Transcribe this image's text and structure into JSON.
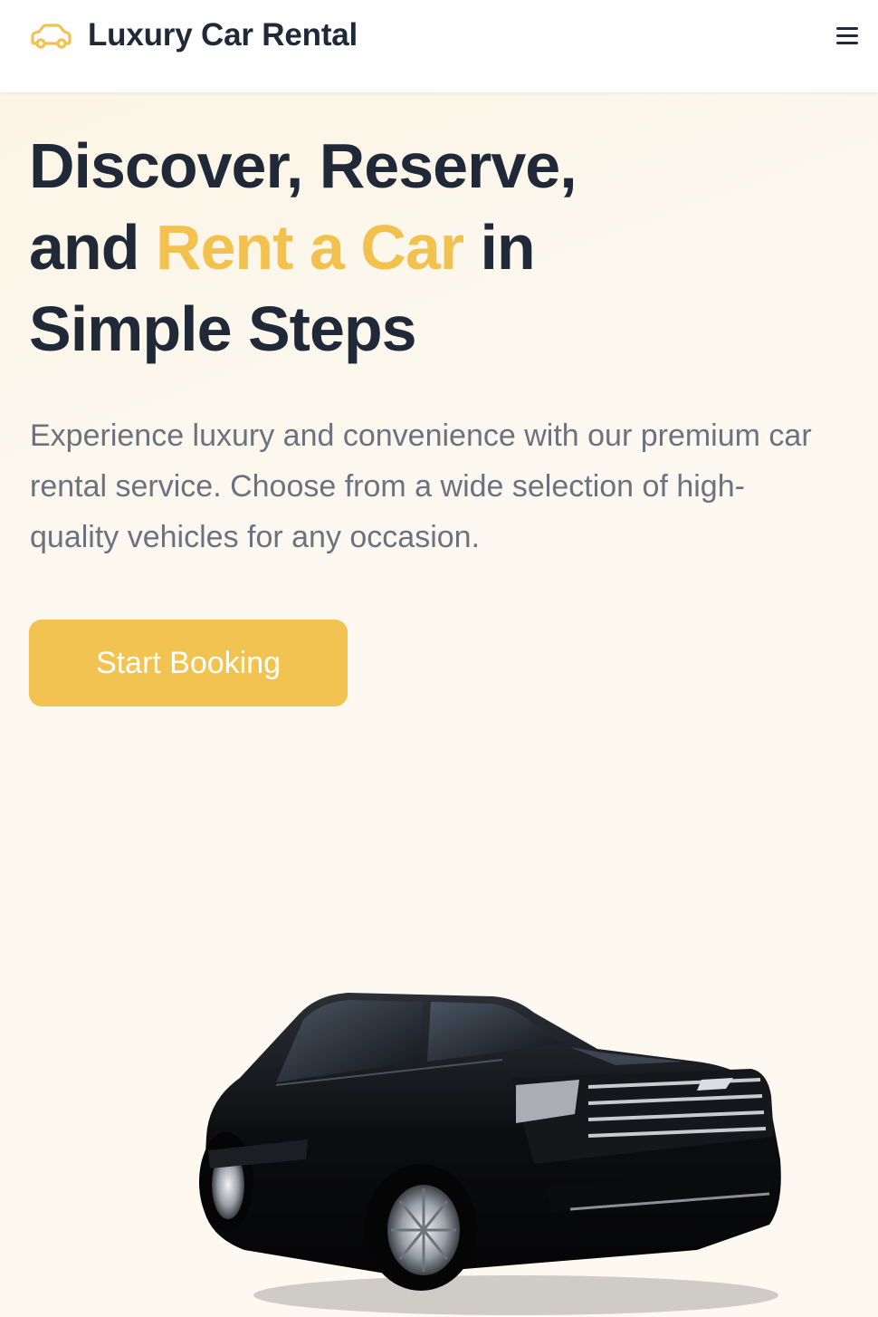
{
  "header": {
    "brand": "Luxury Car Rental",
    "logo_icon": "car-icon",
    "menu_icon": "hamburger-menu-icon"
  },
  "hero": {
    "headline_part1": "Discover, Reserve,",
    "headline_part2_prefix": "and ",
    "headline_accent": "Rent a Car",
    "headline_part2_suffix": " in",
    "headline_part3": "Simple Steps",
    "subtext": "Experience luxury and convenience with our premium car rental service. Choose from a wide selection of high-quality vehicles for any occasion.",
    "cta_label": "Start Booking",
    "image": "black-suv-image"
  },
  "colors": {
    "accent": "#f2c14e",
    "button": "#f2c350",
    "heading": "#1f2937",
    "body_text": "#6b7280",
    "background": "#fbf6ec"
  }
}
